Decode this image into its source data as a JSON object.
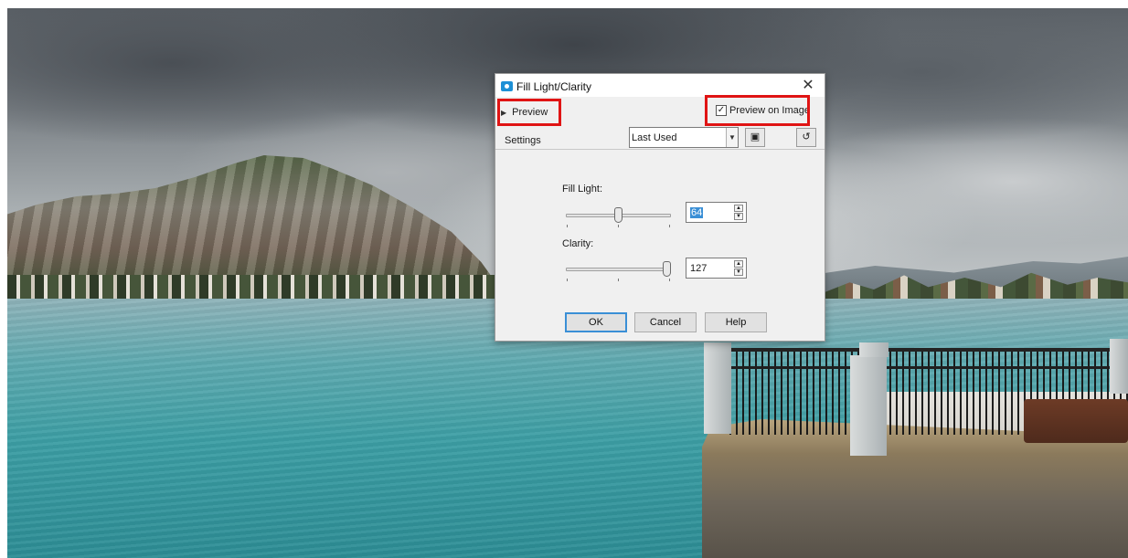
{
  "dialog": {
    "title": "Fill Light/Clarity",
    "close_glyph": "✕",
    "preview_label": "Preview",
    "preview_on_image_label": "Preview on Image",
    "preview_on_image_checked": true,
    "settings_label": "Settings",
    "settings_value": "Last Used",
    "fill_light": {
      "label": "Fill Light:",
      "value": "64",
      "slider_fraction": 0.5
    },
    "clarity": {
      "label": "Clarity:",
      "value": "127",
      "slider_fraction": 1.0
    },
    "buttons": {
      "ok": "OK",
      "cancel": "Cancel",
      "help": "Help"
    }
  },
  "icons": {
    "app": "camera-icon",
    "preview_expand": "triangle-right-icon",
    "save_preset": "floppy-disk-icon",
    "reset": "reset-icon",
    "dropdown": "chevron-down-icon"
  },
  "colors": {
    "highlight": "#e01414",
    "accent": "#3a8fd6",
    "dialog_bg": "#f0f0f0"
  }
}
